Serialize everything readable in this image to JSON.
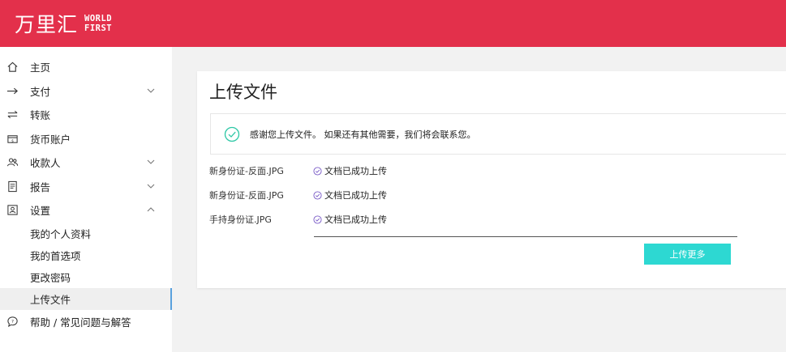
{
  "header": {
    "logo_cn": "万里汇",
    "logo_en_line1": "WORLD",
    "logo_en_line2": "FIRST"
  },
  "sidebar": {
    "items": [
      {
        "label": "主页",
        "icon": "home-icon",
        "expandable": false
      },
      {
        "label": "支付",
        "icon": "arrow-right-icon",
        "expandable": true,
        "expanded": false
      },
      {
        "label": "转账",
        "icon": "transfer-icon",
        "expandable": false
      },
      {
        "label": "货币账户",
        "icon": "wallet-icon",
        "expandable": false
      },
      {
        "label": "收款人",
        "icon": "users-icon",
        "expandable": true,
        "expanded": false
      },
      {
        "label": "报告",
        "icon": "report-icon",
        "expandable": true,
        "expanded": false
      },
      {
        "label": "设置",
        "icon": "settings-icon",
        "expandable": true,
        "expanded": true
      }
    ],
    "settings_sub": [
      {
        "label": "我的个人资料",
        "active": false
      },
      {
        "label": "我的首选项",
        "active": false
      },
      {
        "label": "更改密码",
        "active": false
      },
      {
        "label": "上传文件",
        "active": true
      }
    ],
    "help": {
      "label": "帮助 / 常见问题与解答",
      "icon": "help-chat-icon"
    }
  },
  "main": {
    "title": "上传文件",
    "notice": "感谢您上传文件。 如果还有其他需要，我们将会联系您。",
    "files": [
      {
        "name": "新身份证-反面.JPG",
        "status": "文档已成功上传"
      },
      {
        "name": "新身份证-反面.JPG",
        "status": "文档已成功上传"
      },
      {
        "name": "手持身份证.JPG",
        "status": "文档已成功上传"
      }
    ],
    "upload_more": "上传更多"
  },
  "colors": {
    "brand": "#e3304b",
    "button": "#2dd8d2",
    "success_check": "#2cc7a5",
    "status_check": "#7a5cc7",
    "active_indicator": "#5aa1de"
  }
}
